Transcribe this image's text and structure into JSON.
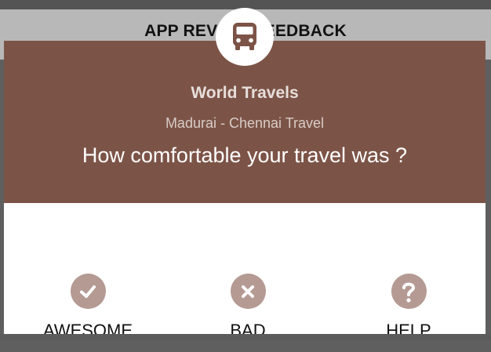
{
  "appbar": {
    "title": "APP REVIEW FEEDBACK"
  },
  "dialog": {
    "icon": "bus-icon",
    "company": "World Travels",
    "route": "Madurai - Chennai Travel",
    "question": "How comfortable your travel was ?",
    "header_color": "#7c5447",
    "options": [
      {
        "label": "AWESOME",
        "icon": "check-icon"
      },
      {
        "label": "BAD",
        "icon": "close-icon"
      },
      {
        "label": "HELP",
        "icon": "question-icon"
      }
    ]
  }
}
